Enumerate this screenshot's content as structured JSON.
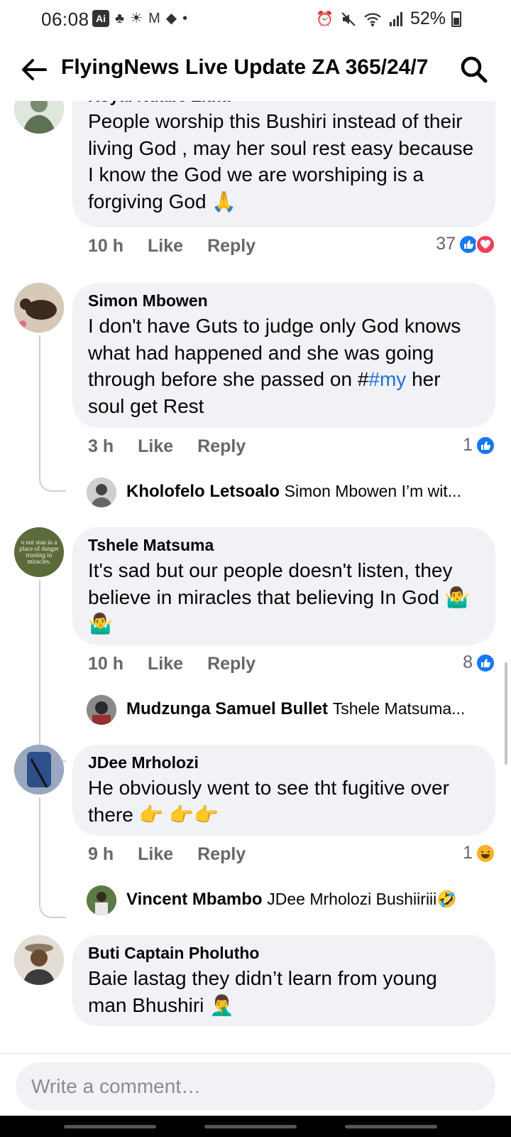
{
  "status_bar": {
    "time": "06:08",
    "ai_badge": "Ai",
    "battery": "52%"
  },
  "header": {
    "title": "FlyingNews Live Update ZA 365/24/7"
  },
  "comments": [
    {
      "author": "Royal Ndabe Zitha",
      "text": "People worship this Bushiri instead of their living God , may her soul rest easy because I know the God we are worshiping is a forgiving God 🙏",
      "time": "10 h",
      "like": "Like",
      "reply": "Reply",
      "reaction_count": "37"
    },
    {
      "author": "Simon Mbowen",
      "text_before": "I don't have Guts to judge only God knows what had happened and she was going through before she passed on #",
      "hashtag": "#my",
      "text_after": " her soul get Rest",
      "time": "3 h",
      "like": "Like",
      "reply": "Reply",
      "reaction_count": "1",
      "reply_preview": {
        "author": "Kholofelo Letsoalo",
        "snippet": "Simon Mbowen I’m wit..."
      }
    },
    {
      "author": "Tshele Matsuma",
      "text": "It's sad but our people doesn't listen, they believe in miracles that believing In God 🤷‍♂️🤷‍♂️",
      "time": "10 h",
      "like": "Like",
      "reply": "Reply",
      "reaction_count": "8",
      "avatar_text": "o not stan in a place of danger trusting in miracles.",
      "reply_preview": {
        "author": "Mudzunga Samuel Bullet",
        "snippet": "Tshele Matsuma..."
      }
    },
    {
      "author": "JDee Mrholozi",
      "text": "He obviously went to see tht fugitive over there 👉 👉👉",
      "time": "9 h",
      "like": "Like",
      "reply": "Reply",
      "reaction_count": "1",
      "reply_preview": {
        "author": "Vincent Mbambo",
        "snippet": "JDee Mrholozi Bushiiriii🤣"
      }
    },
    {
      "author": "Buti Captain Pholutho",
      "text": "Baie lastag they didn’t learn from young man Bhushiri 🤦‍♂️"
    }
  ],
  "composer": {
    "placeholder": "Write a comment…"
  },
  "colors": {
    "bubble": "#f0f2f5",
    "meta_text": "#65676b",
    "link": "#216fdb",
    "like_blue": "#1877f2",
    "love_red": "#f33e58"
  }
}
